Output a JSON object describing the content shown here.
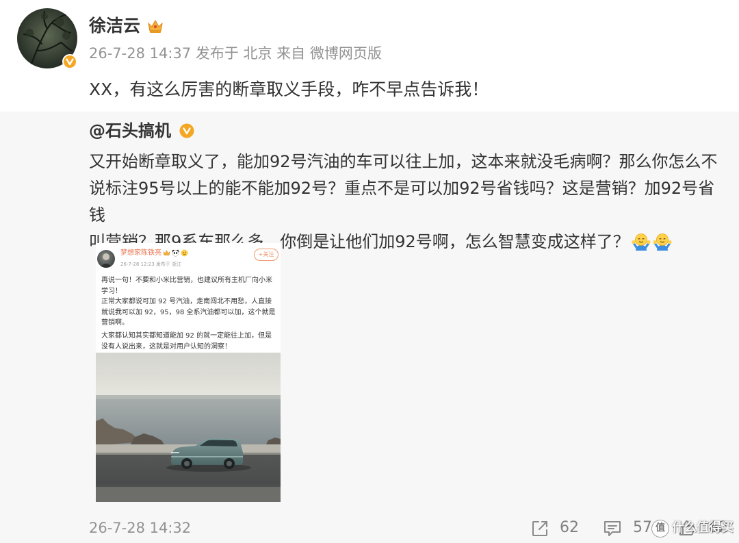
{
  "post": {
    "author": {
      "name": "徐洁云",
      "avatar_icon": "avatar",
      "verified_badge_icon": "verified-v-icon",
      "member_icon": "crown-icon"
    },
    "meta": "26-7-28 14:37 发布于 北京 来自 微博网页版",
    "text": "XX，有这么厉害的断章取义手段，咋不早点告诉我！"
  },
  "retweet": {
    "author": {
      "name": "@石头搞机",
      "verified_badge_icon": "verified-v-icon"
    },
    "text_lines": [
      "又开始断章取义了，能加92号汽油的车可以往上加，这本来就没毛病啊？那么你怎么不",
      "说标注95号以上的能不能加92号？重点不是可以加92号省钱吗？这是营销？加92号省钱",
      "叫营销？那9系车那么多，你倒是让他们加92号啊，怎么智慧变成这样了？"
    ],
    "trailing_emoji": [
      "shrug-emoji-icon",
      "shrug-emoji-icon"
    ],
    "image": {
      "author_name": "梦想家陈铁亮",
      "author_icons": [
        "crown-icon",
        "panda-icon",
        "smiley-icon"
      ],
      "meta": "26-7-28 12:23 发布于 浙江",
      "follow_label": "+关注",
      "text_lines": [
        "再说一句！不要和小米比营销，也建议所有主机厂向小米",
        "学习！",
        "正常大家都说可加 92 号汽油，走南闯北不用愁，人直接",
        "就说我可以加 92，95，98 全系汽油都可以加，这个就是",
        "营销啊。",
        "大家都认知其实都知道能加 92 的就一定能往上加，但是",
        "没有人说出来，这就是对用户认知的洞察！"
      ]
    },
    "footer": {
      "time": "26-7-28 14:32",
      "share_icon": "share-icon",
      "share_count": "62",
      "comment_icon": "comment-icon",
      "comment_count": "57",
      "like_icon": "like-icon",
      "like_count": "82"
    }
  },
  "watermark": {
    "logo_char": "值",
    "text": "什么值得买"
  },
  "colors": {
    "text": "#333333",
    "meta": "#939393",
    "retweet_background": "#f7f7f7",
    "verified_badge": "#f5a623",
    "embedded_author_name": "#eb7350",
    "action_icons": "#8a8a8a"
  }
}
